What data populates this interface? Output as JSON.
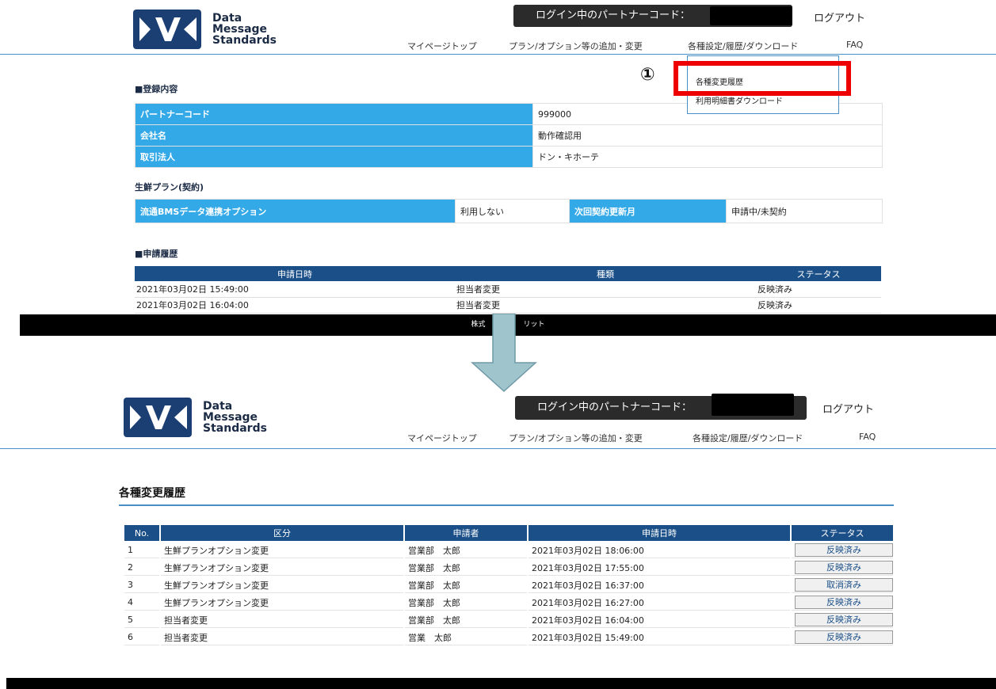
{
  "brand": {
    "line1": "Data",
    "line2": "Message",
    "line3": "Standards",
    "color": "#1b3f73"
  },
  "header": {
    "login_label": "ログイン中のパートナーコード：",
    "logout": "ログアウト",
    "nav": [
      "マイページトップ",
      "プラン/オプション等の追加・変更",
      "各種設定/履歴/ダウンロード",
      "FAQ"
    ]
  },
  "dropdown": {
    "items": [
      "各種変更履歴",
      "利用明細書ダウンロード"
    ]
  },
  "annotation": {
    "marker": "①",
    "highlight_color": "#ee0000"
  },
  "registration": {
    "heading": "■登録内容",
    "rows": [
      {
        "label": "パートナーコード",
        "value": "999000"
      },
      {
        "label": "会社名",
        "value": "動作確認用"
      },
      {
        "label": "取引法人",
        "value": "ドン・キホーテ"
      }
    ]
  },
  "plan": {
    "heading": "生鮮プラン(契約)",
    "option_label": "流通BMSデータ連携オプション",
    "option_value": "利用しない",
    "renewal_label": "次回契約更新月",
    "renewal_value": "申請中/未契約"
  },
  "applications": {
    "heading": "■申請履歴",
    "columns": [
      "申請日時",
      "種類",
      "ステータス"
    ],
    "rows": [
      [
        "2021年03月02日 15:49:00",
        "担当者変更",
        "反映済み"
      ],
      [
        "2021年03月02日 16:04:00",
        "担当者変更",
        "反映済み"
      ]
    ]
  },
  "footer": {
    "text_left": "株式",
    "text_right": "リット"
  },
  "history": {
    "title": "各種変更履歴",
    "columns": [
      "No.",
      "区分",
      "申請者",
      "申請日時",
      "ステータス"
    ],
    "rows": [
      [
        "1",
        "生鮮プランオプション変更",
        "営業部　太郎",
        "2021年03月02日 18:06:00",
        "反映済み"
      ],
      [
        "2",
        "生鮮プランオプション変更",
        "営業部　太郎",
        "2021年03月02日 17:55:00",
        "反映済み"
      ],
      [
        "3",
        "生鮮プランオプション変更",
        "営業部　太郎",
        "2021年03月02日 16:37:00",
        "取消済み"
      ],
      [
        "4",
        "生鮮プランオプション変更",
        "営業部　太郎",
        "2021年03月02日 16:27:00",
        "反映済み"
      ],
      [
        "5",
        "担当者変更",
        "営業部　太郎",
        "2021年03月02日 16:04:00",
        "反映済み"
      ],
      [
        "6",
        "担当者変更",
        "営業　太郎",
        "2021年03月02日 15:49:00",
        "反映済み"
      ]
    ]
  },
  "colors": {
    "header_blue": "#1b4f88",
    "label_blue": "#34a9e8",
    "line_blue": "#4a90c8",
    "arrow": "#9fc4cc"
  }
}
